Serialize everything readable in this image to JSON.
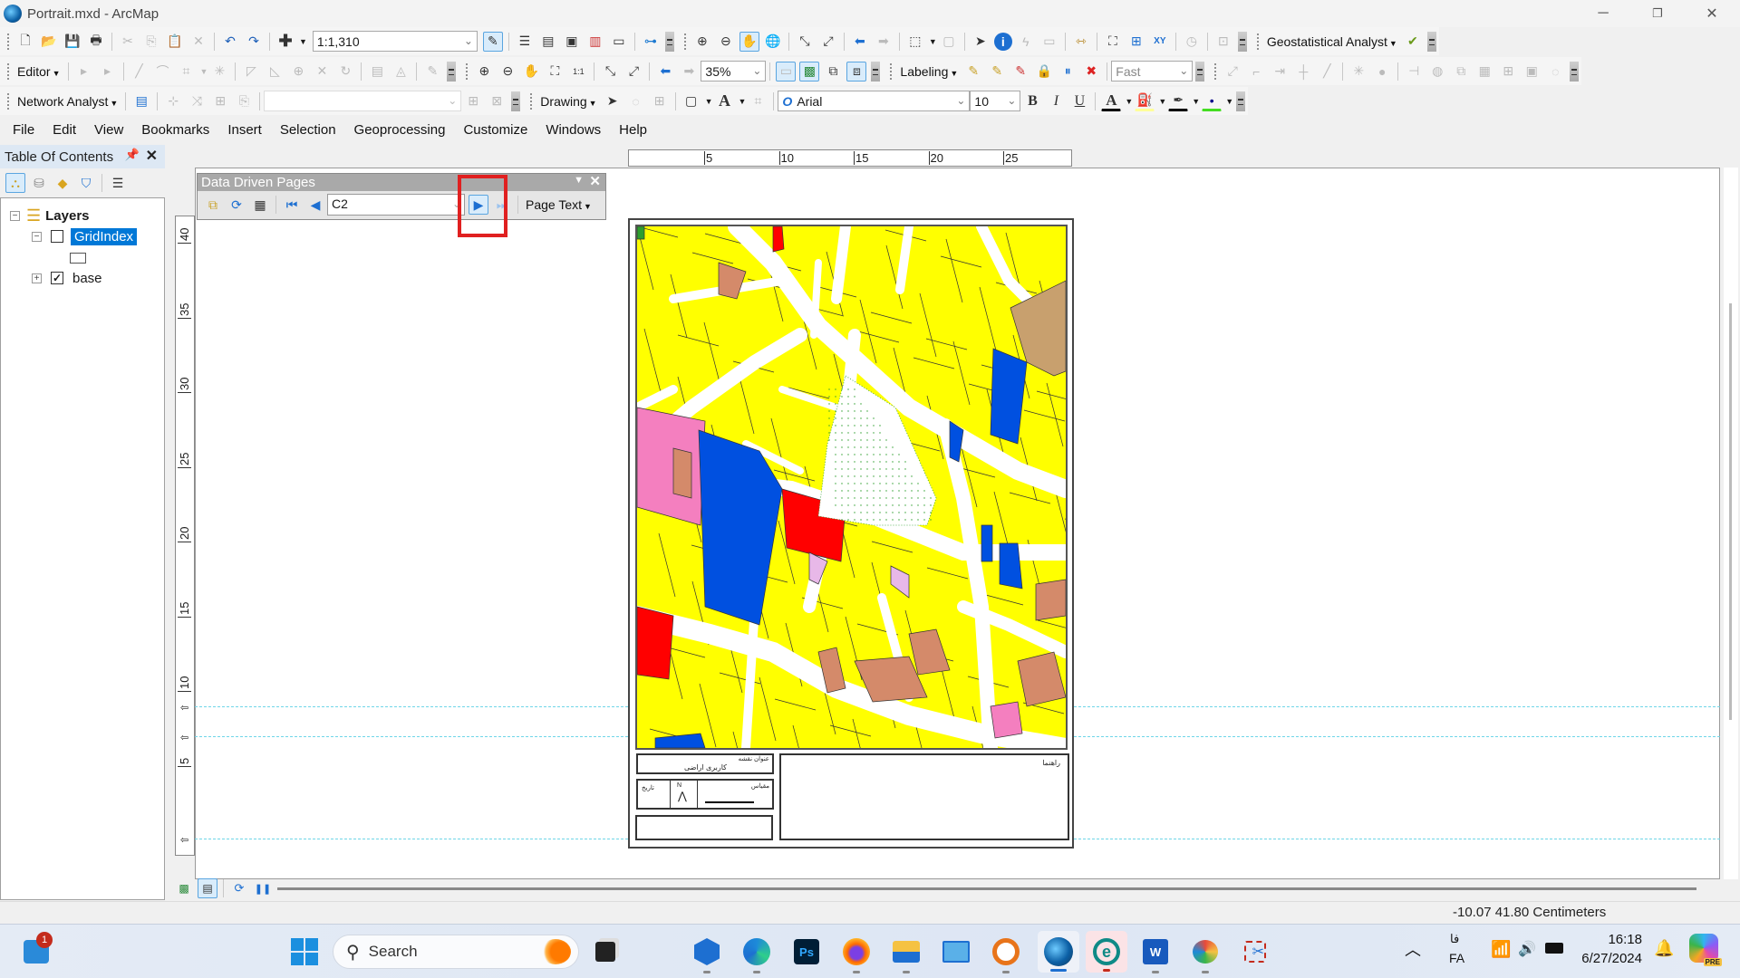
{
  "window": {
    "title": "Portrait.mxd - ArcMap",
    "controls": {
      "minimize": "─",
      "restore": "❐",
      "close": "✕"
    }
  },
  "toolbars": {
    "standard": {
      "scale": "1:1,310",
      "geostatistical_label": "Geostatistical Analyst"
    },
    "editor_label": "Editor",
    "layout": {
      "zoom_percent": "35%"
    },
    "labeling": {
      "label": "Labeling",
      "quality": "Fast"
    },
    "network_analyst_label": "Network Analyst",
    "drawing": {
      "label": "Drawing",
      "font": "Arial",
      "font_size": "10",
      "bold": "B",
      "italic": "I",
      "underline": "U",
      "font_color": "#000000",
      "fill_color": "#ffff99",
      "line_color": "#000000",
      "marker_color": "#44dd22"
    }
  },
  "menu": [
    "File",
    "Edit",
    "View",
    "Bookmarks",
    "Insert",
    "Selection",
    "Geoprocessing",
    "Customize",
    "Windows",
    "Help"
  ],
  "toc": {
    "title": "Table Of Contents",
    "pin": "ᚱ",
    "close": "✕",
    "root": "Layers",
    "layers": [
      {
        "name": "GridIndex",
        "checked": false,
        "selected": true,
        "expanded": true
      },
      {
        "name": "base",
        "checked": true,
        "selected": false,
        "expanded": false
      }
    ]
  },
  "ddp": {
    "title": "Data Driven Pages",
    "current_page": "C2",
    "page_text_label": "Page Text",
    "highlighted_button": "next-page"
  },
  "rulers": {
    "horizontal": [
      "5",
      "10",
      "15",
      "20",
      "25"
    ],
    "vertical": [
      "40",
      "35",
      "30",
      "25",
      "20",
      "15",
      "10",
      "5"
    ]
  },
  "page": {
    "title_block": {
      "title_label": "عنوان نقشه",
      "title_value": "کاربری اراضی",
      "scale_label": "مقیاس",
      "date_label": "تاریخ",
      "legend_label": "راهنما",
      "north": "N"
    },
    "map_colors": {
      "residential": "#ffff00",
      "education": "#0050e0",
      "commercial": "#ff0000",
      "health": "#f47fbf",
      "services": "#d48a6a",
      "green": "#2e9e2e",
      "tan": "#c8a06e",
      "lilac": "#e8b8e8",
      "orange": "#ff9900"
    }
  },
  "status": {
    "coords": "-10.07  41.80 Centimeters"
  },
  "taskbar": {
    "search_placeholder": "Search",
    "widget_badge": "1",
    "lang_top": "فا",
    "lang_bottom": "FA",
    "time": "16:18",
    "date": "6/27/2024",
    "copilot_badge": "PRE"
  }
}
